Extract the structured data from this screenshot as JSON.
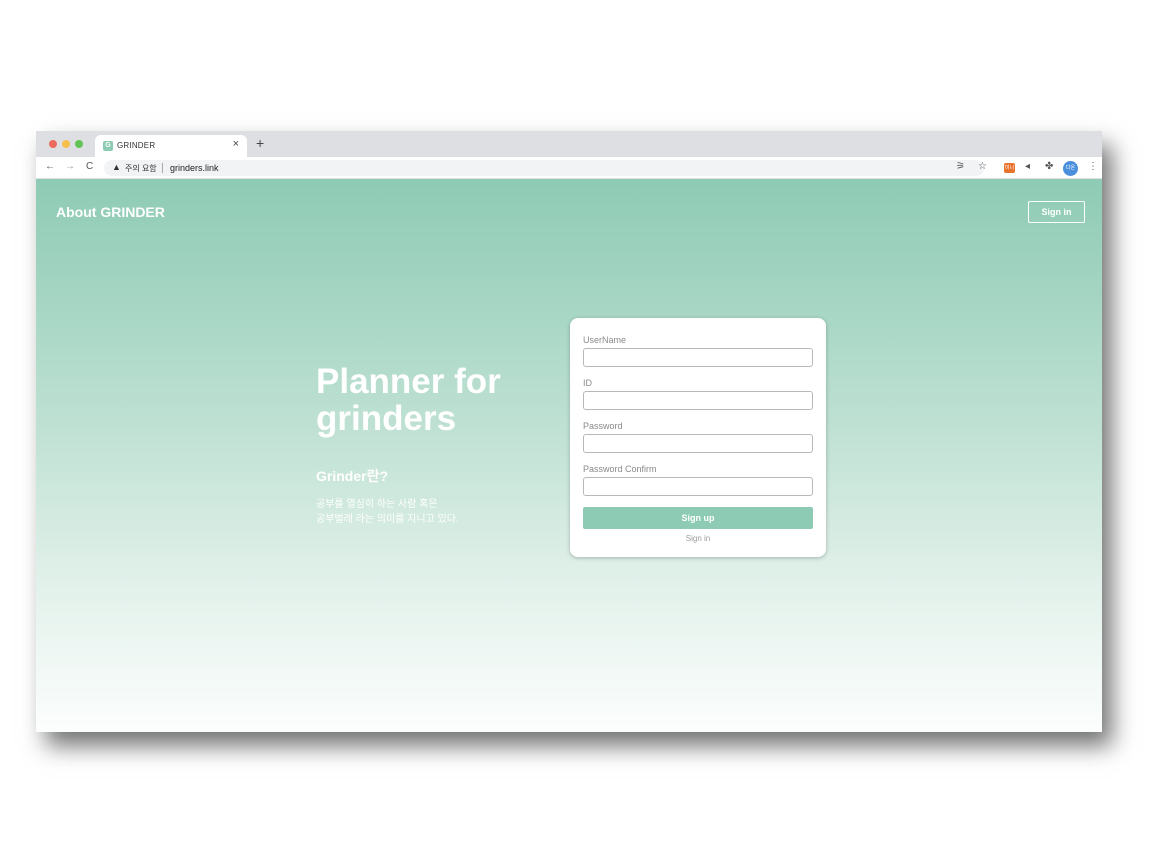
{
  "browser": {
    "tab": {
      "favicon": "G",
      "title": "GRINDER",
      "close": "×"
    },
    "new_tab": "+",
    "nav": {
      "back": "←",
      "forward": "→",
      "reload": "C"
    },
    "address": {
      "security_icon": "warning-triangle-icon",
      "security_text": "주의 요함",
      "url": "grinders.link"
    },
    "extensions": {
      "ext1": "미니",
      "avatar": "다온"
    }
  },
  "header": {
    "brand": "About GRINDER",
    "signin_label": "Sign in"
  },
  "hero": {
    "title": "Planner for grinders",
    "subtitle": "Grinder란?",
    "desc_line1": "공부를 열심히 하는 사람 혹은",
    "desc_line2": "공부벌레 라는 의미를 지니고 있다."
  },
  "form": {
    "fields": [
      {
        "label": "UserName",
        "value": ""
      },
      {
        "label": "ID",
        "value": ""
      },
      {
        "label": "Password",
        "value": ""
      },
      {
        "label": "Password Confirm",
        "value": ""
      }
    ],
    "submit_label": "Sign up",
    "signin_link": "Sign in"
  },
  "colors": {
    "accent": "#8ecbb4"
  }
}
